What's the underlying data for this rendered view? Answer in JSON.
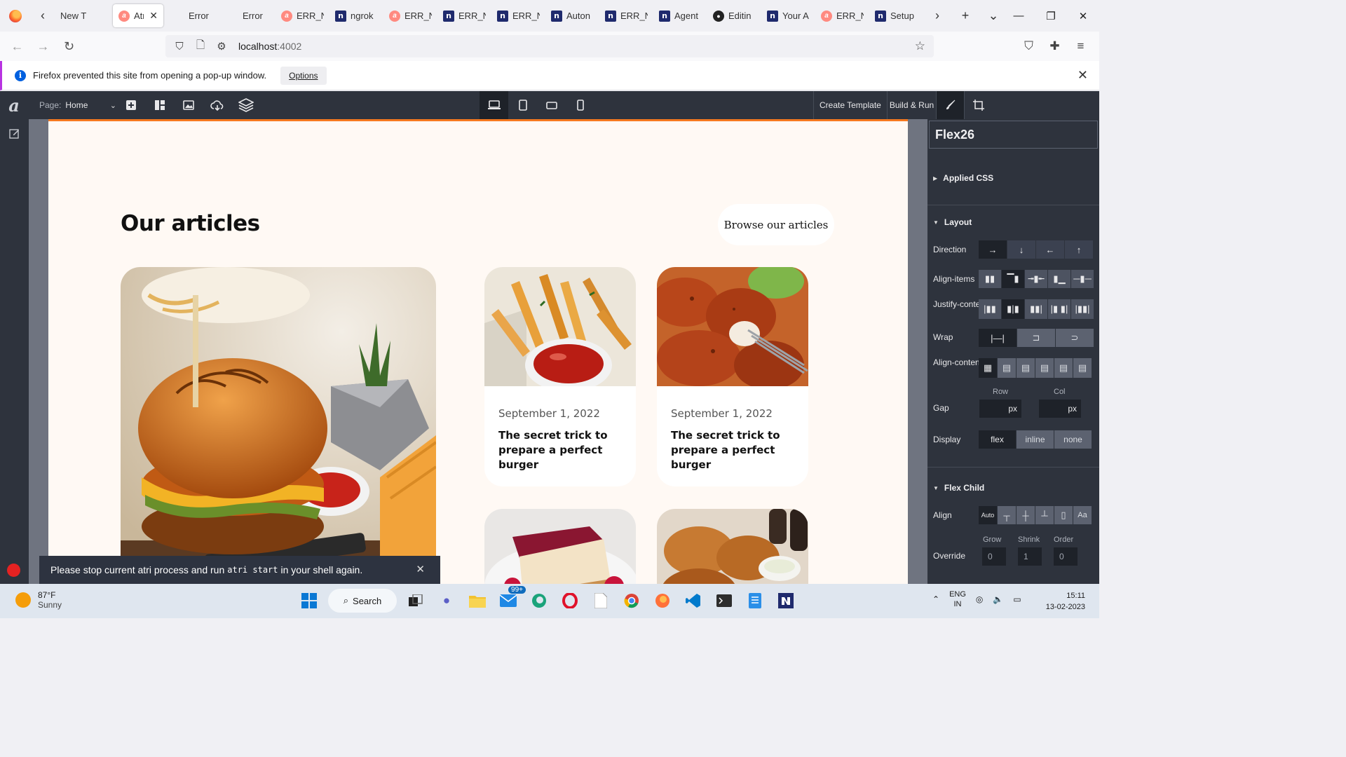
{
  "browser": {
    "tabs": [
      {
        "title": "New T",
        "favicon": "firefox-icon",
        "active": false
      },
      {
        "title": "Atri",
        "favicon": "atri-icon",
        "active": true
      },
      {
        "title": "Error",
        "favicon": "none",
        "active": false
      },
      {
        "title": "Error",
        "favicon": "none",
        "active": false
      },
      {
        "title": "ERR_N",
        "favicon": "atri-icon",
        "active": false
      },
      {
        "title": "ngrok",
        "favicon": "n-icon",
        "active": false
      },
      {
        "title": "ERR_N",
        "favicon": "atri-icon",
        "active": false
      },
      {
        "title": "ERR_N",
        "favicon": "n-icon",
        "active": false
      },
      {
        "title": "ERR_N",
        "favicon": "n-icon",
        "active": false
      },
      {
        "title": "Auton",
        "favicon": "n-icon",
        "active": false
      },
      {
        "title": "ERR_N",
        "favicon": "n-icon",
        "active": false
      },
      {
        "title": "Agent",
        "favicon": "n-icon",
        "active": false
      },
      {
        "title": "Editin",
        "favicon": "github-icon",
        "active": false
      },
      {
        "title": "Your A",
        "favicon": "n-icon",
        "active": false
      },
      {
        "title": "ERR_N",
        "favicon": "atri-icon",
        "active": false
      },
      {
        "title": "Setup",
        "favicon": "n-icon",
        "active": false
      }
    ],
    "url_host": "localhost",
    "url_port": ":4002",
    "notification": {
      "text": "Firefox prevented this site from opening a pop-up window.",
      "button": "Options"
    }
  },
  "editor": {
    "page_label": "Page:",
    "page_value": "Home",
    "create_template": "Create Template",
    "build_run": "Build & Run"
  },
  "canvas": {
    "section_title": "Our articles",
    "browse_button": "Browse our articles",
    "cards": [
      {
        "date": "September 1, 2022",
        "title": "The secret trick to prepare a perfect burger"
      },
      {
        "date": "September 1, 2022",
        "title": "The secret trick to prepare a perfect burger"
      }
    ],
    "toast": {
      "prefix": "Please stop current atri process and run",
      "code": "atri start",
      "suffix": "in your shell again."
    }
  },
  "panel": {
    "component_name": "Flex26",
    "applied_css": "Applied CSS",
    "layout": "Layout",
    "direction": "Direction",
    "align_items": "Align-items",
    "justify_content": "Justify-content",
    "wrap": "Wrap",
    "align_content": "Align-content",
    "row": "Row",
    "col": "Col",
    "gap": "Gap",
    "gap_unit_row": "px",
    "gap_unit_col": "px",
    "display": "Display",
    "display_options": [
      "flex",
      "inline",
      "none"
    ],
    "flex_child": "Flex Child",
    "align": "Align",
    "align_auto": "Auto",
    "override": "Override",
    "grow": "Grow",
    "shrink": "Shrink",
    "order": "Order",
    "grow_value": "0",
    "shrink_value": "1",
    "order_value": "0"
  },
  "taskbar": {
    "temp": "87°F",
    "weather": "Sunny",
    "search": "Search",
    "mail_badge": "99+",
    "lang1": "ENG",
    "lang2": "IN",
    "time": "15:11",
    "date": "13-02-2023"
  },
  "colors": {
    "editor_bg": "#2e333d",
    "canvas_accent": "#f5791f",
    "canvas_bg": "#fff9f4"
  }
}
